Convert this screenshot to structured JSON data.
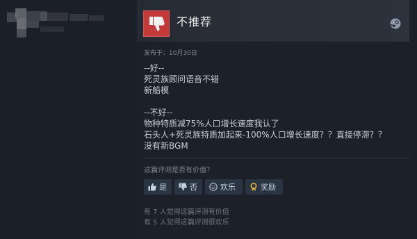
{
  "review": {
    "recommendation": "不推荐",
    "posted_date": "发布于：10月30日",
    "lines": [
      "--好--",
      "死灵族顾问语音不错",
      "新船模",
      "",
      "--不好--",
      "物种特质减75%人口增长速度我认了",
      "石头人+死灵族特质加起来-100%人口增长速度？？直接停滞？？",
      "没有新BGM"
    ],
    "helpful_question": "这篇评测是否有价值？",
    "buttons": {
      "yes": "是",
      "no": "否",
      "funny": "欢乐",
      "award": "奖励"
    },
    "helpful_count_text": "有 7 人觉得这篇评测有价值",
    "funny_count_text": "有 5 人觉得这篇评测很欢乐"
  },
  "icons": {
    "thumb": "thumbs-down-icon",
    "platform": "steam-icon"
  },
  "colors": {
    "not_recommended": "#c23a3a",
    "button_bg": "#2a3443",
    "award_icon": "#e3b33a"
  }
}
